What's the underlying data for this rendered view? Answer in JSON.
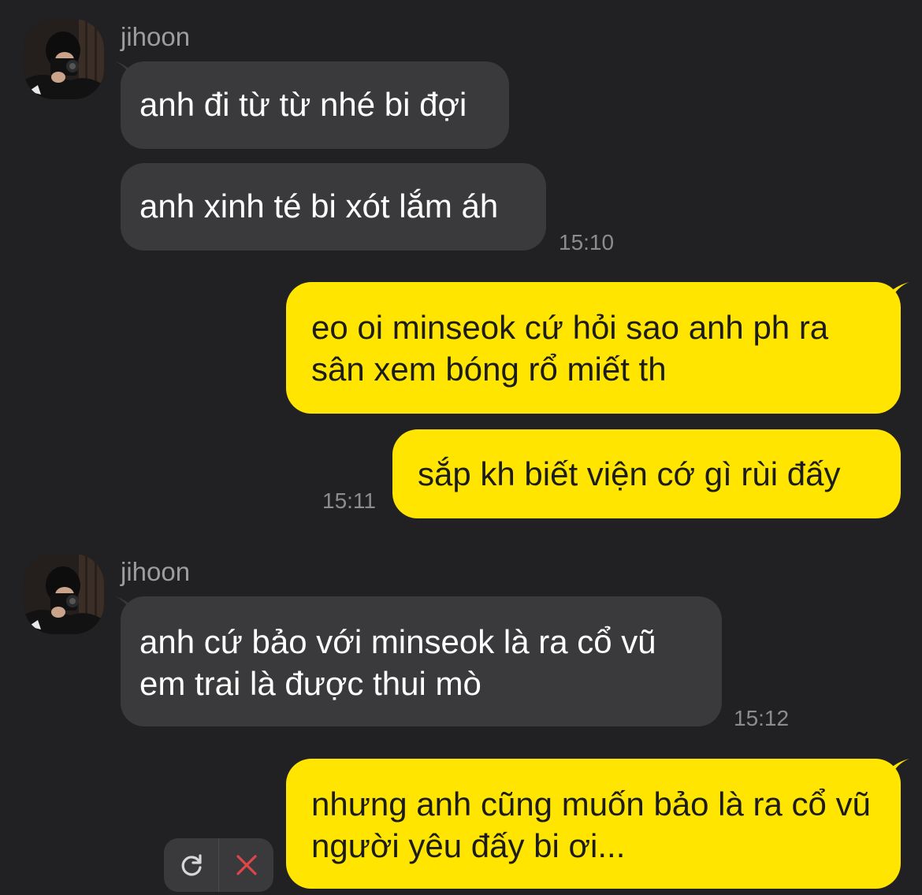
{
  "colors": {
    "background": "#212123",
    "incoming_bubble": "#3a3a3c",
    "outgoing_bubble": "#ffe500",
    "timestamp": "#8c8c8e",
    "sender_name": "#9d9d9f",
    "cancel_x": "#e0454a"
  },
  "groups": [
    {
      "sender": "jihoon",
      "messages": [
        "anh đi từ từ nhé bi đợi",
        "anh xinh té bi xót lắm áh"
      ],
      "time": "15:10"
    },
    {
      "messages": [
        "eo oi minseok cứ hỏi sao anh ph ra sân xem bóng rổ miết th",
        "sắp kh biết viện cớ gì rùi đấy"
      ],
      "time": "15:11"
    },
    {
      "sender": "jihoon",
      "messages": [
        "anh cứ bảo với minseok là ra cổ vũ em trai là được thui mò"
      ],
      "time": "15:12"
    },
    {
      "messages": [
        "nhưng anh cũng muốn bảo là ra cổ vũ người yêu đấy bi ơi..."
      ],
      "failed_actions": {
        "retry_icon": "refresh-icon",
        "cancel_icon": "close-icon"
      }
    }
  ]
}
